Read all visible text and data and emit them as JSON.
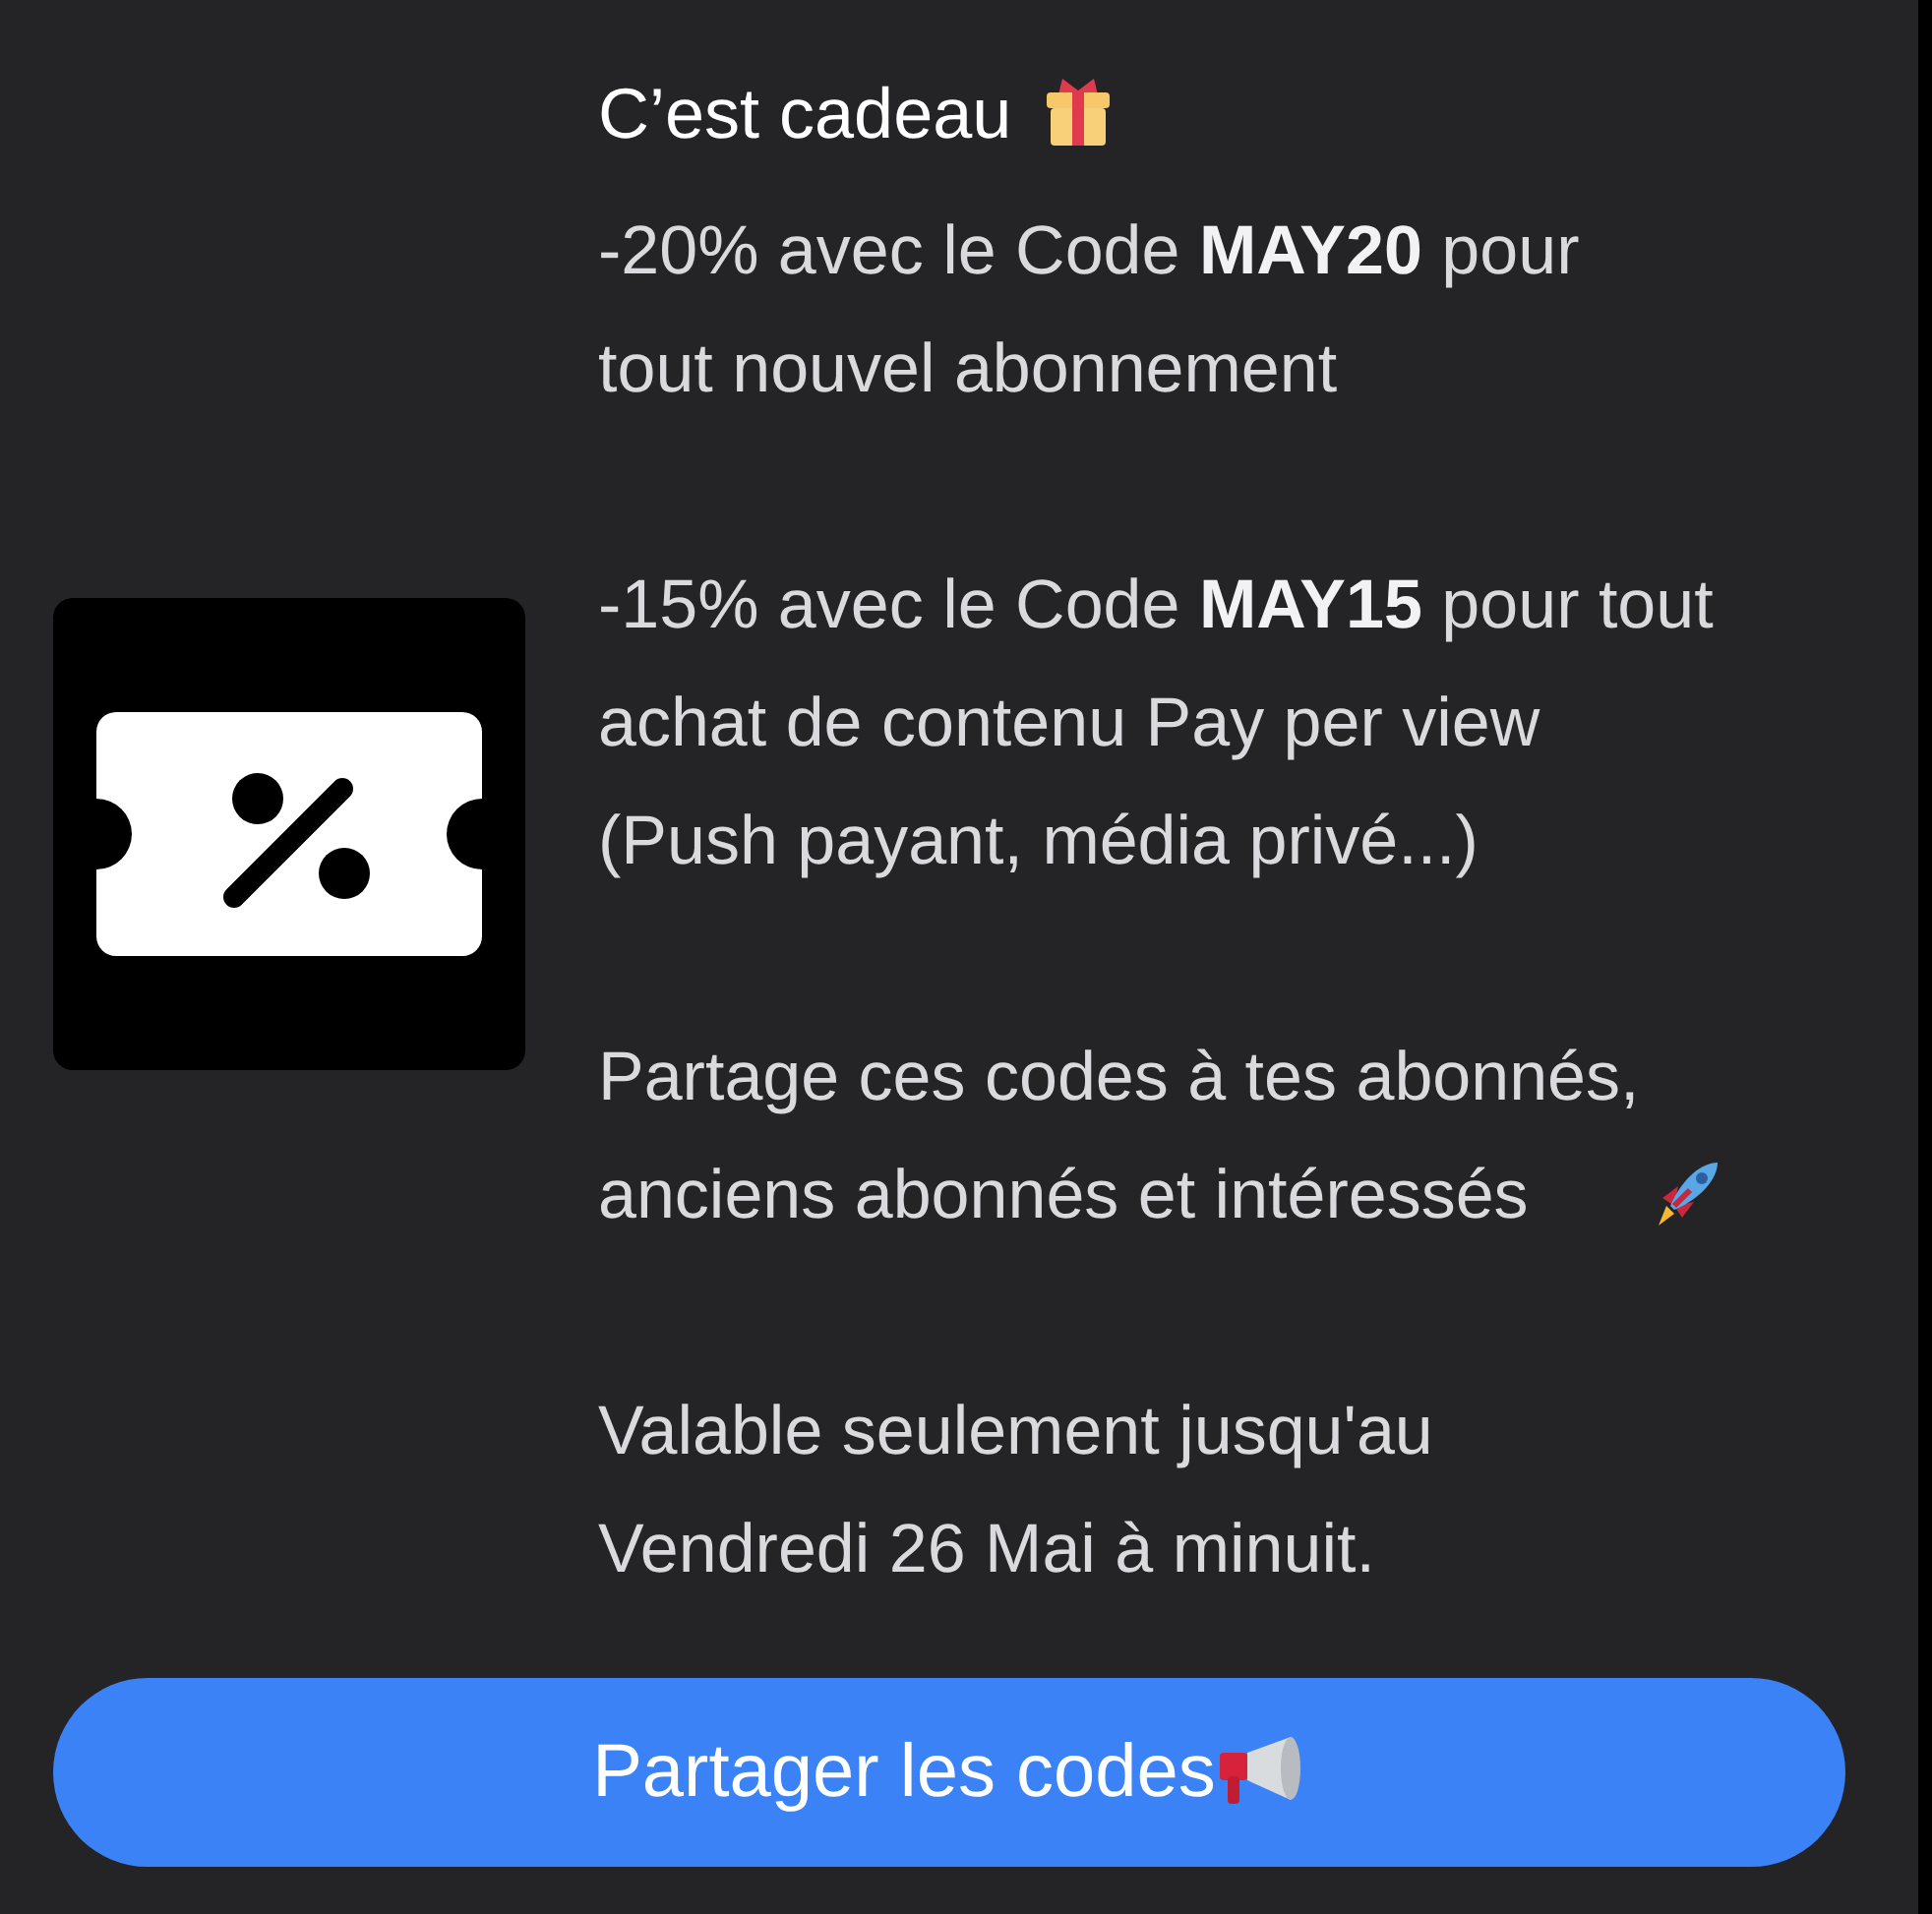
{
  "title": "C’est cadeau",
  "paragraphs": [
    {
      "text": "-20% avec le Code **MAY20** pour\ntout nouvel abonnement"
    },
    {
      "text": "-15% avec le Code **MAY15** pour tout\nachat de contenu Pay per view\n(Push payant, média privé...)"
    },
    {
      "text": "Partage ces codes à tes abonnés,\nanciens abonnés et intéressés"
    },
    {
      "text": "Valable seulement jusqu'au\nVendredi 26 Mai à minuit."
    }
  ],
  "button": {
    "label": "Partager les codes"
  }
}
